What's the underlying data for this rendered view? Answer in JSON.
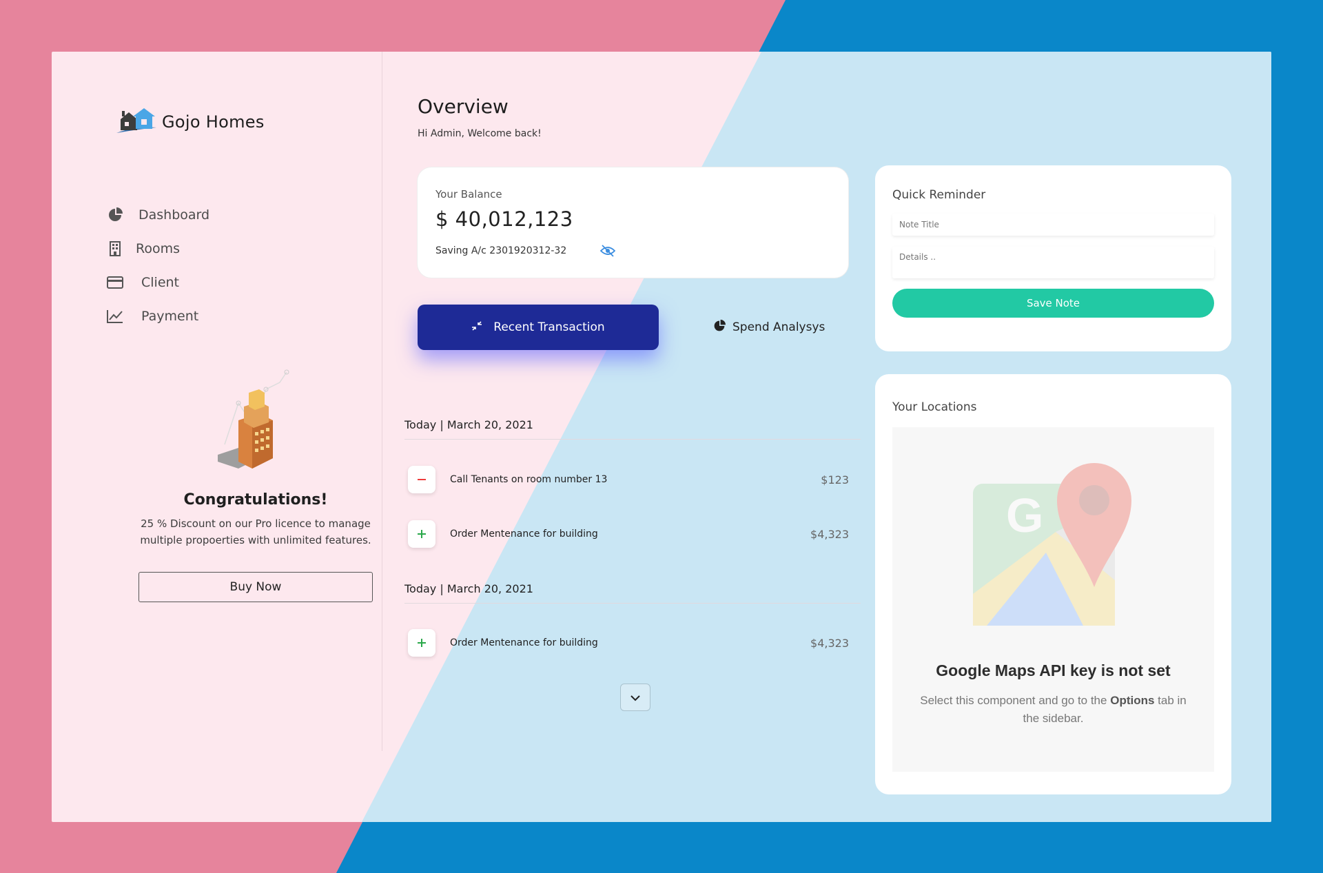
{
  "brand": {
    "name": "Gojo Homes"
  },
  "sidebar": {
    "items": [
      {
        "label": "Dashboard",
        "icon": "pie-chart-icon"
      },
      {
        "label": "Rooms",
        "icon": "building-icon"
      },
      {
        "label": "Client",
        "icon": "credit-card-icon"
      },
      {
        "label": "Payment",
        "icon": "line-chart-icon"
      }
    ]
  },
  "promo": {
    "title": "Congratulations!",
    "text": "25 % Discount on our Pro licence to manage multiple propoerties with unlimited features.",
    "button_label": "Buy Now"
  },
  "header": {
    "title": "Overview",
    "subtitle": "Hi Admin, Welcome back!"
  },
  "balance": {
    "label": "Your Balance",
    "value": "$ 40,012,123",
    "account": "Saving A/c 2301920312-32"
  },
  "tabs": {
    "recent_label": "Recent Transaction",
    "spend_label": "Spend Analysys"
  },
  "transactions": {
    "groups": [
      {
        "date": "Today | March 20, 2021",
        "items": [
          {
            "type": "minus",
            "label": "Call Tenants on room number 13",
            "amount": "$123"
          },
          {
            "type": "plus",
            "label": "Order Mentenance for building",
            "amount": "$4,323"
          }
        ]
      },
      {
        "date": "Today | March 20, 2021",
        "items": [
          {
            "type": "plus",
            "label": "Order Mentenance for building",
            "amount": "$4,323"
          }
        ]
      }
    ]
  },
  "reminder": {
    "title": "Quick Reminder",
    "title_placeholder": "Note Title",
    "details_placeholder": "Details ..",
    "save_label": "Save Note"
  },
  "locations": {
    "title": "Your Locations",
    "error_title": "Google Maps API key is not set",
    "error_text_before": "Select this component and go to the",
    "error_text_bold": "Options",
    "error_text_after": "tab in the sidebar."
  },
  "colors": {
    "accent_navy": "#1e2a96",
    "accent_teal": "#22c9a4",
    "minus_red": "#ee3b3b",
    "plus_green": "#2aa84a",
    "eye_blue": "#3b8de0"
  }
}
